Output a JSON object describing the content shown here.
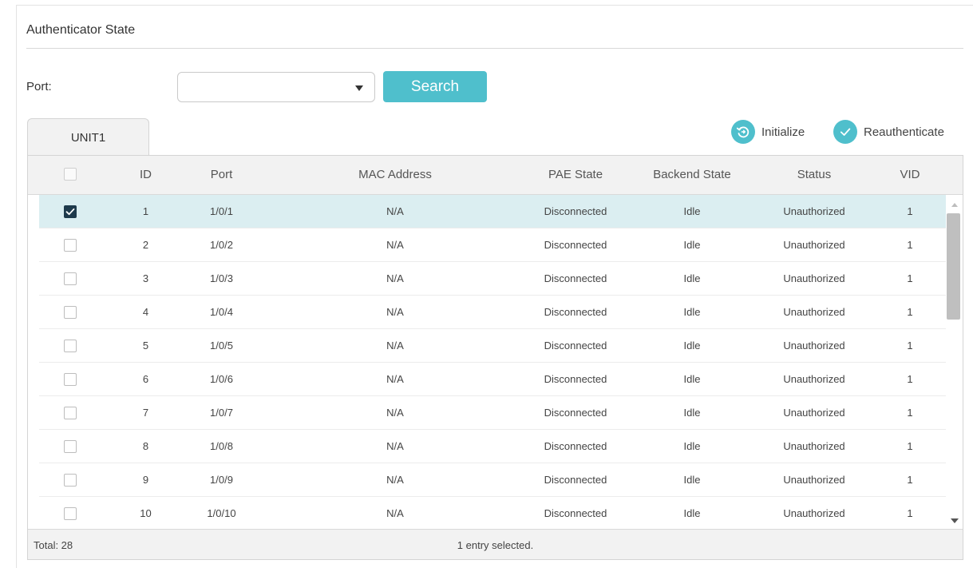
{
  "section": {
    "title": "Authenticator State"
  },
  "filter": {
    "port_label": "Port:",
    "port_value": "",
    "search_label": "Search"
  },
  "tabs": [
    {
      "label": "UNIT1",
      "active": true
    }
  ],
  "actions": {
    "initialize": "Initialize",
    "reauthenticate": "Reauthenticate"
  },
  "colors": {
    "accent": "#4fbfcc",
    "selected_row": "#dbeef1",
    "checkbox_checked": "#1e3a4c"
  },
  "table": {
    "columns": [
      "ID",
      "Port",
      "MAC Address",
      "PAE State",
      "Backend State",
      "Status",
      "VID"
    ],
    "rows": [
      {
        "checked": true,
        "id": "1",
        "port": "1/0/1",
        "mac": "N/A",
        "pae": "Disconnected",
        "backend": "Idle",
        "status": "Unauthorized",
        "vid": "1"
      },
      {
        "checked": false,
        "id": "2",
        "port": "1/0/2",
        "mac": "N/A",
        "pae": "Disconnected",
        "backend": "Idle",
        "status": "Unauthorized",
        "vid": "1"
      },
      {
        "checked": false,
        "id": "3",
        "port": "1/0/3",
        "mac": "N/A",
        "pae": "Disconnected",
        "backend": "Idle",
        "status": "Unauthorized",
        "vid": "1"
      },
      {
        "checked": false,
        "id": "4",
        "port": "1/0/4",
        "mac": "N/A",
        "pae": "Disconnected",
        "backend": "Idle",
        "status": "Unauthorized",
        "vid": "1"
      },
      {
        "checked": false,
        "id": "5",
        "port": "1/0/5",
        "mac": "N/A",
        "pae": "Disconnected",
        "backend": "Idle",
        "status": "Unauthorized",
        "vid": "1"
      },
      {
        "checked": false,
        "id": "6",
        "port": "1/0/6",
        "mac": "N/A",
        "pae": "Disconnected",
        "backend": "Idle",
        "status": "Unauthorized",
        "vid": "1"
      },
      {
        "checked": false,
        "id": "7",
        "port": "1/0/7",
        "mac": "N/A",
        "pae": "Disconnected",
        "backend": "Idle",
        "status": "Unauthorized",
        "vid": "1"
      },
      {
        "checked": false,
        "id": "8",
        "port": "1/0/8",
        "mac": "N/A",
        "pae": "Disconnected",
        "backend": "Idle",
        "status": "Unauthorized",
        "vid": "1"
      },
      {
        "checked": false,
        "id": "9",
        "port": "1/0/9",
        "mac": "N/A",
        "pae": "Disconnected",
        "backend": "Idle",
        "status": "Unauthorized",
        "vid": "1"
      },
      {
        "checked": false,
        "id": "10",
        "port": "1/0/10",
        "mac": "N/A",
        "pae": "Disconnected",
        "backend": "Idle",
        "status": "Unauthorized",
        "vid": "1"
      }
    ]
  },
  "footer": {
    "total": "Total: 28",
    "selected": "1 entry selected."
  }
}
